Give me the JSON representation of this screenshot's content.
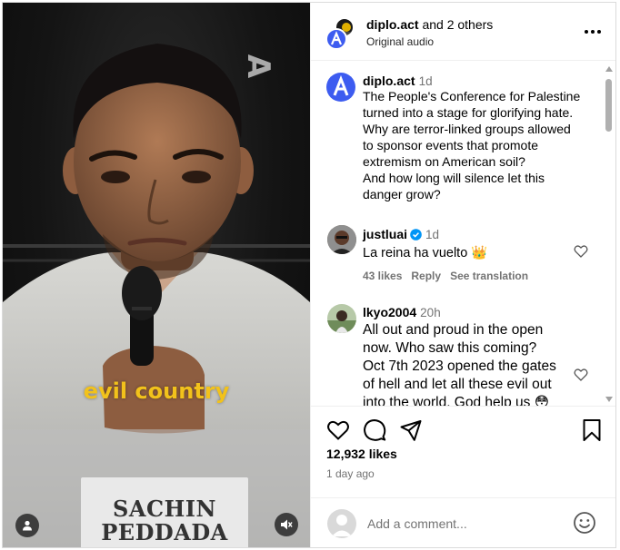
{
  "video": {
    "watermark": "A",
    "caption": "evil country",
    "nameplate": [
      "SACHIN",
      "PEDDADA"
    ],
    "icons": {
      "user": "user-icon",
      "mute": "speaker-muted-icon"
    }
  },
  "header": {
    "username": "diplo.act",
    "others": " and 2 others",
    "subtitle": "Original audio",
    "more_icon": "more-horizontal-icon"
  },
  "caption_post": {
    "username": "diplo.act",
    "time": "1d",
    "lines": [
      "The People's Conference for Palestine",
      "turned into a stage for glorifying hate.",
      "Why are terror-linked groups allowed",
      "to sponsor events that promote",
      "extremism on American soil?",
      "And how long will silence let this",
      "danger grow?"
    ]
  },
  "comments": [
    {
      "username": "justluai",
      "verified": true,
      "time": "1d",
      "text": "La reina ha vuelto 👑",
      "likes": "43 likes",
      "reply": "Reply",
      "translate": "See translation"
    },
    {
      "username": "lkyo2004",
      "time": "20h",
      "lines": [
        "All out and proud in the open",
        "now. Who saw this coming?",
        "Oct 7th 2023 opened the gates",
        "of hell and let all these evil out",
        "into the world. God help us 😳"
      ]
    }
  ],
  "actions": {
    "icons": [
      "heart-icon",
      "comment-icon",
      "share-icon",
      "bookmark-icon"
    ],
    "likes": "12,932 likes",
    "date": "1 day ago"
  },
  "add_comment": {
    "placeholder": "Add a comment...",
    "emoji_icon": "smiley-icon"
  },
  "colors": {
    "caption_yellow": "#f2c21b",
    "brand_blue": "#3d5cf0",
    "verified_blue": "#0095f6",
    "muted_text": "#737373"
  }
}
